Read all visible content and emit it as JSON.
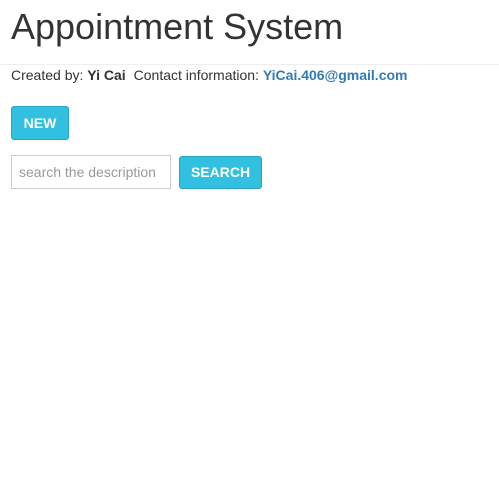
{
  "header": {
    "title": "Appointment System"
  },
  "credits": {
    "created_by_label": "Created by:",
    "author": "Yi Cai",
    "contact_label": "Contact information:",
    "email": "YiCai.406@gmail.com"
  },
  "actions": {
    "new_label": "NEW"
  },
  "search": {
    "placeholder": "search the description",
    "value": "",
    "button_label": "SEARCH"
  },
  "colors": {
    "button_bg": "#31c0df",
    "link": "#337ab7",
    "text": "#333333"
  }
}
